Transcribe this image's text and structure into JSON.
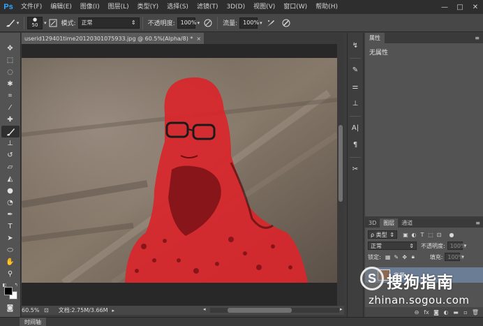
{
  "app": {
    "logo": "Ps"
  },
  "menu": [
    "文件(F)",
    "编辑(E)",
    "图像(I)",
    "图层(L)",
    "类型(Y)",
    "选择(S)",
    "滤镜(T)",
    "3D(D)",
    "视图(V)",
    "窗口(W)",
    "帮助(H)"
  ],
  "window_controls": {
    "minimize": "—",
    "restore": "□",
    "close": "✕"
  },
  "options": {
    "brush_size": "50",
    "mode_label": "模式:",
    "mode_value": "正常",
    "opacity_label": "不透明度:",
    "opacity_value": "100%",
    "flow_label": "流量:",
    "flow_value": "100%"
  },
  "document": {
    "tab_title": "userid129401time20120301075933.jpg @ 60.5%(Alpha/8) *",
    "tab_close": "×"
  },
  "status": {
    "zoom": "60.5%",
    "doc_info": "文档:2.75M/3.66M"
  },
  "timeline": {
    "label": "时间轴"
  },
  "properties": {
    "tabs": [
      "属性"
    ],
    "body": "无属性"
  },
  "layers": {
    "tabs": [
      "3D",
      "图层",
      "通道"
    ],
    "active_tab": "图层",
    "filter_kind": "ρ 类型",
    "blend_mode": "正常",
    "opacity_label": "不透明度:",
    "opacity_value": "100%",
    "lock_label": "锁定:",
    "fill_label": "填充:",
    "fill_value": "100%",
    "layer_name": "背景"
  },
  "watermark": {
    "logo_letter": "S",
    "brand": "搜狗指南",
    "url": "zhinan.sogou.com"
  },
  "colors": {
    "selection_overlay": "#d9262b",
    "ps_blue": "#31a8ff",
    "layer_selected": "#6b7d95"
  }
}
